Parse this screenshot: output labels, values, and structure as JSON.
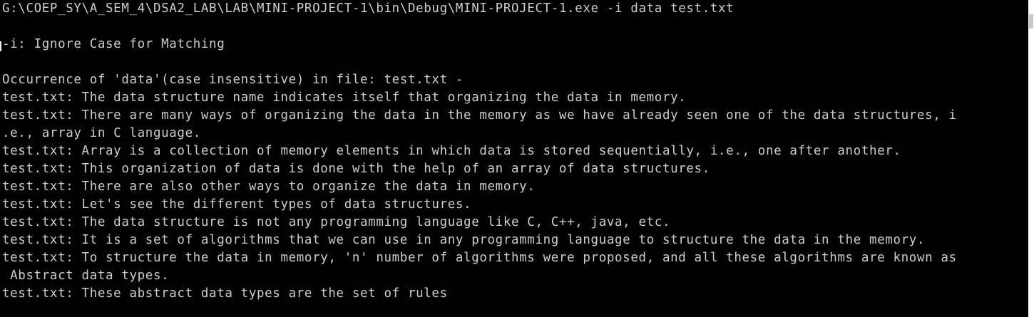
{
  "console": {
    "lines": [
      "G:\\COEP_SY\\A_SEM_4\\DSA2_LAB\\LAB\\MINI-PROJECT-1\\bin\\Debug\\MINI-PROJECT-1.exe -i data test.txt",
      "",
      "-i: Ignore Case for Matching",
      "",
      "Occurrence of 'data'(case insensitive) in file: test.txt -",
      "test.txt: The data structure name indicates itself that organizing the data in memory.",
      "test.txt: There are many ways of organizing the data in the memory as we have already seen one of the data structures, i",
      ".e., array in C language.",
      "test.txt: Array is a collection of memory elements in which data is stored sequentially, i.e., one after another.",
      "test.txt: This organization of data is done with the help of an array of data structures.",
      "test.txt: There are also other ways to organize the data in memory.",
      "test.txt: Let's see the different types of data structures.",
      "test.txt: The data structure is not any programming language like C, C++, java, etc.",
      "test.txt: It is a set of algorithms that we can use in any programming language to structure the data in the memory.",
      "test.txt: To structure the data in memory, 'n' number of algorithms were proposed, and all these algorithms are known as",
      " Abstract data types.",
      "test.txt: These abstract data types are the set of rules"
    ]
  },
  "colors": {
    "background": "#000000",
    "text": "#cccccc",
    "scrollbar": "#ffffff"
  }
}
